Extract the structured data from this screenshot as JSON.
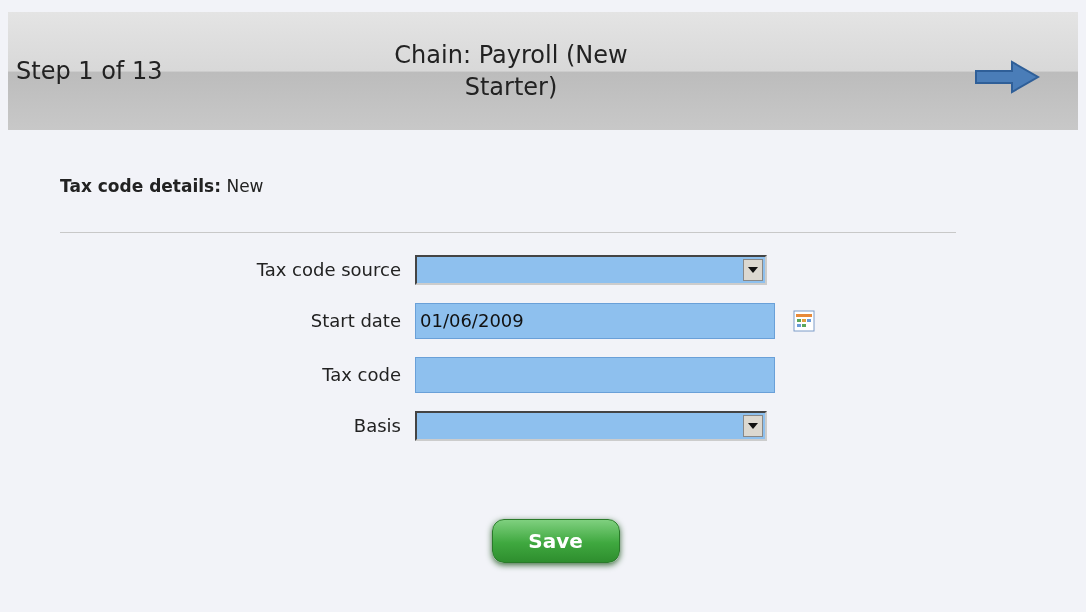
{
  "header": {
    "step": "Step 1 of 13",
    "title": "Chain: Payroll (New Starter)"
  },
  "section": {
    "label": "Tax code details:",
    "value": "New"
  },
  "fields": [
    {
      "label": "Tax code source",
      "kind": "select"
    },
    {
      "label": "Start date",
      "kind": "date",
      "value": "01/06/2009"
    },
    {
      "label": "Tax code",
      "kind": "text"
    },
    {
      "label": "Basis",
      "kind": "select"
    }
  ],
  "buttons": [
    "Save"
  ]
}
